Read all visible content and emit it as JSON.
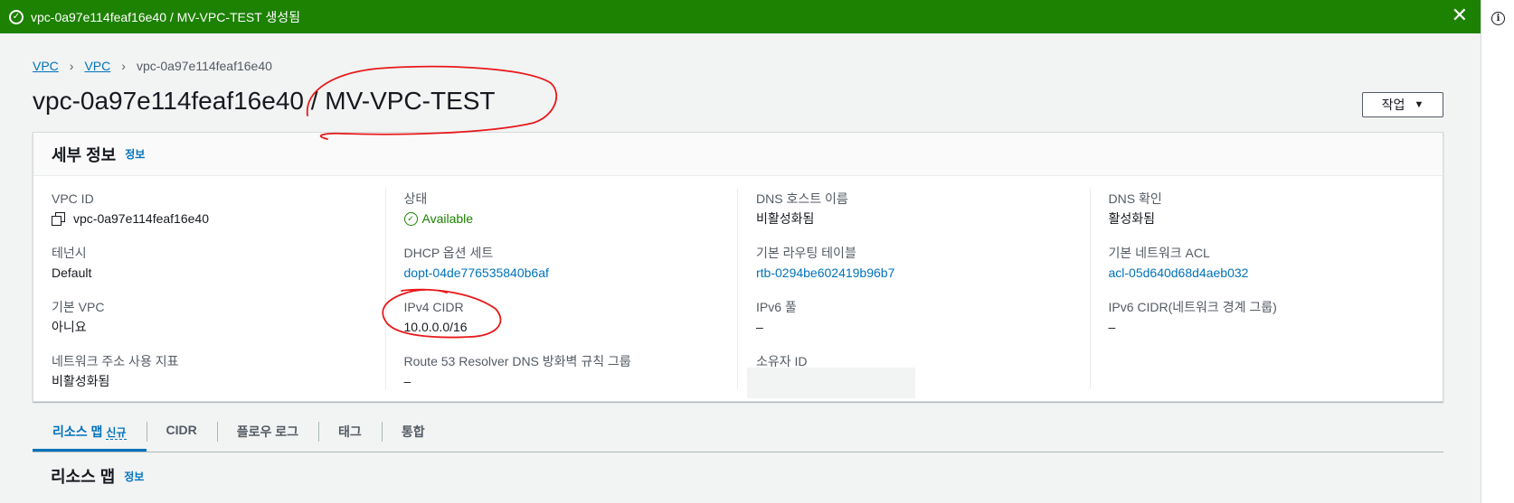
{
  "banner": {
    "message": "vpc-0a97e114feaf16e40 / MV-VPC-TEST 생성됨",
    "ok_icon": "✓",
    "close_icon": "✕",
    "color": "#1d8102"
  },
  "rightbar": {
    "info_icon": "i"
  },
  "breadcrumb": {
    "items": [
      "VPC",
      "VPC"
    ],
    "current": "vpc-0a97e114feaf16e40",
    "separator": "›"
  },
  "page": {
    "title": "vpc-0a97e114feaf16e40 / MV-VPC-TEST",
    "action_label": "작업",
    "action_caret": "▼"
  },
  "details": {
    "heading": "세부 정보",
    "info_label": "정보",
    "columns": [
      [
        {
          "label": "VPC ID",
          "value": "vpc-0a97e114feaf16e40"
        },
        {
          "label": "테넌시",
          "value": "Default"
        },
        {
          "label": "기본 VPC",
          "value": "아니요"
        },
        {
          "label": "네트워크 주소 사용 지표",
          "value": "비활성화됨"
        }
      ],
      [
        {
          "label": "상태",
          "value": "Available"
        },
        {
          "label": "DHCP 옵션 세트",
          "value": "dopt-04de776535840b6af"
        },
        {
          "label": "IPv4 CIDR",
          "value": "10.0.0.0/16"
        },
        {
          "label": "Route 53 Resolver DNS 방화벽 규칙 그룹",
          "value": "–"
        }
      ],
      [
        {
          "label": "DNS 호스트 이름",
          "value": "비활성화됨"
        },
        {
          "label": "기본 라우팅 테이블",
          "value": "rtb-0294be602419b96b7"
        },
        {
          "label": "IPv6 풀",
          "value": "–"
        },
        {
          "label": "소유자 ID",
          "value": ""
        }
      ],
      [
        {
          "label": "DNS 확인",
          "value": "활성화됨"
        },
        {
          "label": "기본 네트워크 ACL",
          "value": "acl-05d640d68d4aeb032"
        },
        {
          "label": "IPv6 CIDR(네트워크 경계 그룹)",
          "value": "–"
        }
      ]
    ],
    "status_icon": "✓"
  },
  "tabs": [
    {
      "label": "리소스 맵",
      "badge": "신규"
    },
    {
      "label": "CIDR"
    },
    {
      "label": "플로우 로그"
    },
    {
      "label": "태그"
    },
    {
      "label": "통합"
    }
  ],
  "resource_map": {
    "heading": "리소스 맵",
    "info_label": "정보"
  }
}
